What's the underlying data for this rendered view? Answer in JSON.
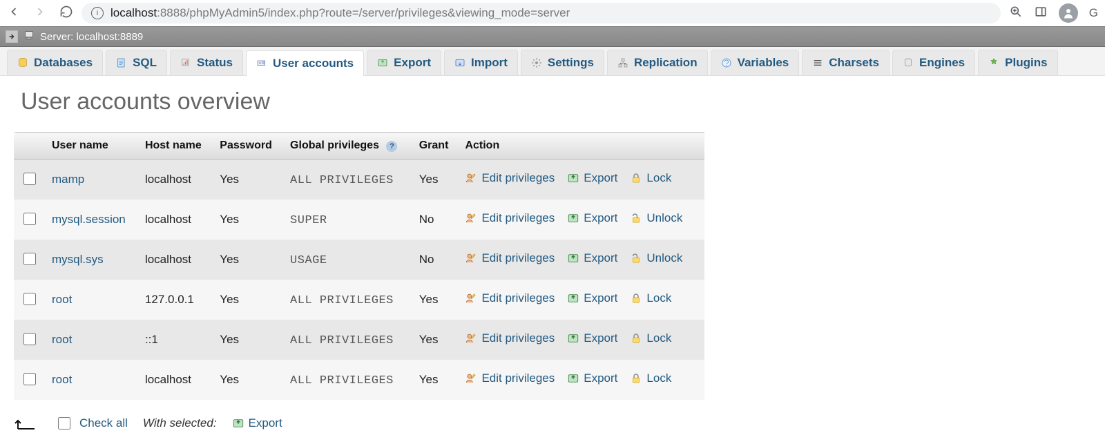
{
  "browser": {
    "url_host": "localhost",
    "url_port": ":8888",
    "url_path": "/phpMyAdmin5/index.php?route=/server/privileges&viewing_mode=server",
    "guest_initial": "G"
  },
  "server_bar": {
    "label": "Server:",
    "value": "localhost:8889"
  },
  "tabs": [
    {
      "id": "databases",
      "label": "Databases",
      "icon": "db-icon"
    },
    {
      "id": "sql",
      "label": "SQL",
      "icon": "sql-icon"
    },
    {
      "id": "status",
      "label": "Status",
      "icon": "status-icon"
    },
    {
      "id": "user-accounts",
      "label": "User accounts",
      "icon": "users-icon",
      "active": true
    },
    {
      "id": "export",
      "label": "Export",
      "icon": "export-icon"
    },
    {
      "id": "import",
      "label": "Import",
      "icon": "import-icon"
    },
    {
      "id": "settings",
      "label": "Settings",
      "icon": "gear-icon"
    },
    {
      "id": "replication",
      "label": "Replication",
      "icon": "replication-icon"
    },
    {
      "id": "variables",
      "label": "Variables",
      "icon": "variables-icon"
    },
    {
      "id": "charsets",
      "label": "Charsets",
      "icon": "charsets-icon"
    },
    {
      "id": "engines",
      "label": "Engines",
      "icon": "engines-icon"
    },
    {
      "id": "plugins",
      "label": "Plugins",
      "icon": "plugins-icon"
    }
  ],
  "page": {
    "title": "User accounts overview"
  },
  "table": {
    "headers": {
      "check": "",
      "user_name": "User name",
      "host_name": "Host name",
      "password": "Password",
      "global_privileges": "Global privileges",
      "grant": "Grant",
      "action": "Action"
    },
    "action_labels": {
      "edit_privileges": "Edit privileges",
      "export": "Export",
      "lock": "Lock",
      "unlock": "Unlock"
    },
    "rows": [
      {
        "user": "mamp",
        "host": "localhost",
        "password": "Yes",
        "privileges": "ALL PRIVILEGES",
        "grant": "Yes",
        "lock_state": "lock"
      },
      {
        "user": "mysql.session",
        "host": "localhost",
        "password": "Yes",
        "privileges": "SUPER",
        "grant": "No",
        "lock_state": "unlock"
      },
      {
        "user": "mysql.sys",
        "host": "localhost",
        "password": "Yes",
        "privileges": "USAGE",
        "grant": "No",
        "lock_state": "unlock"
      },
      {
        "user": "root",
        "host": "127.0.0.1",
        "password": "Yes",
        "privileges": "ALL PRIVILEGES",
        "grant": "Yes",
        "lock_state": "lock"
      },
      {
        "user": "root",
        "host": "::1",
        "password": "Yes",
        "privileges": "ALL PRIVILEGES",
        "grant": "Yes",
        "lock_state": "lock"
      },
      {
        "user": "root",
        "host": "localhost",
        "password": "Yes",
        "privileges": "ALL PRIVILEGES",
        "grant": "Yes",
        "lock_state": "lock"
      }
    ]
  },
  "footer": {
    "check_all": "Check all",
    "with_selected": "With selected:",
    "export": "Export"
  }
}
